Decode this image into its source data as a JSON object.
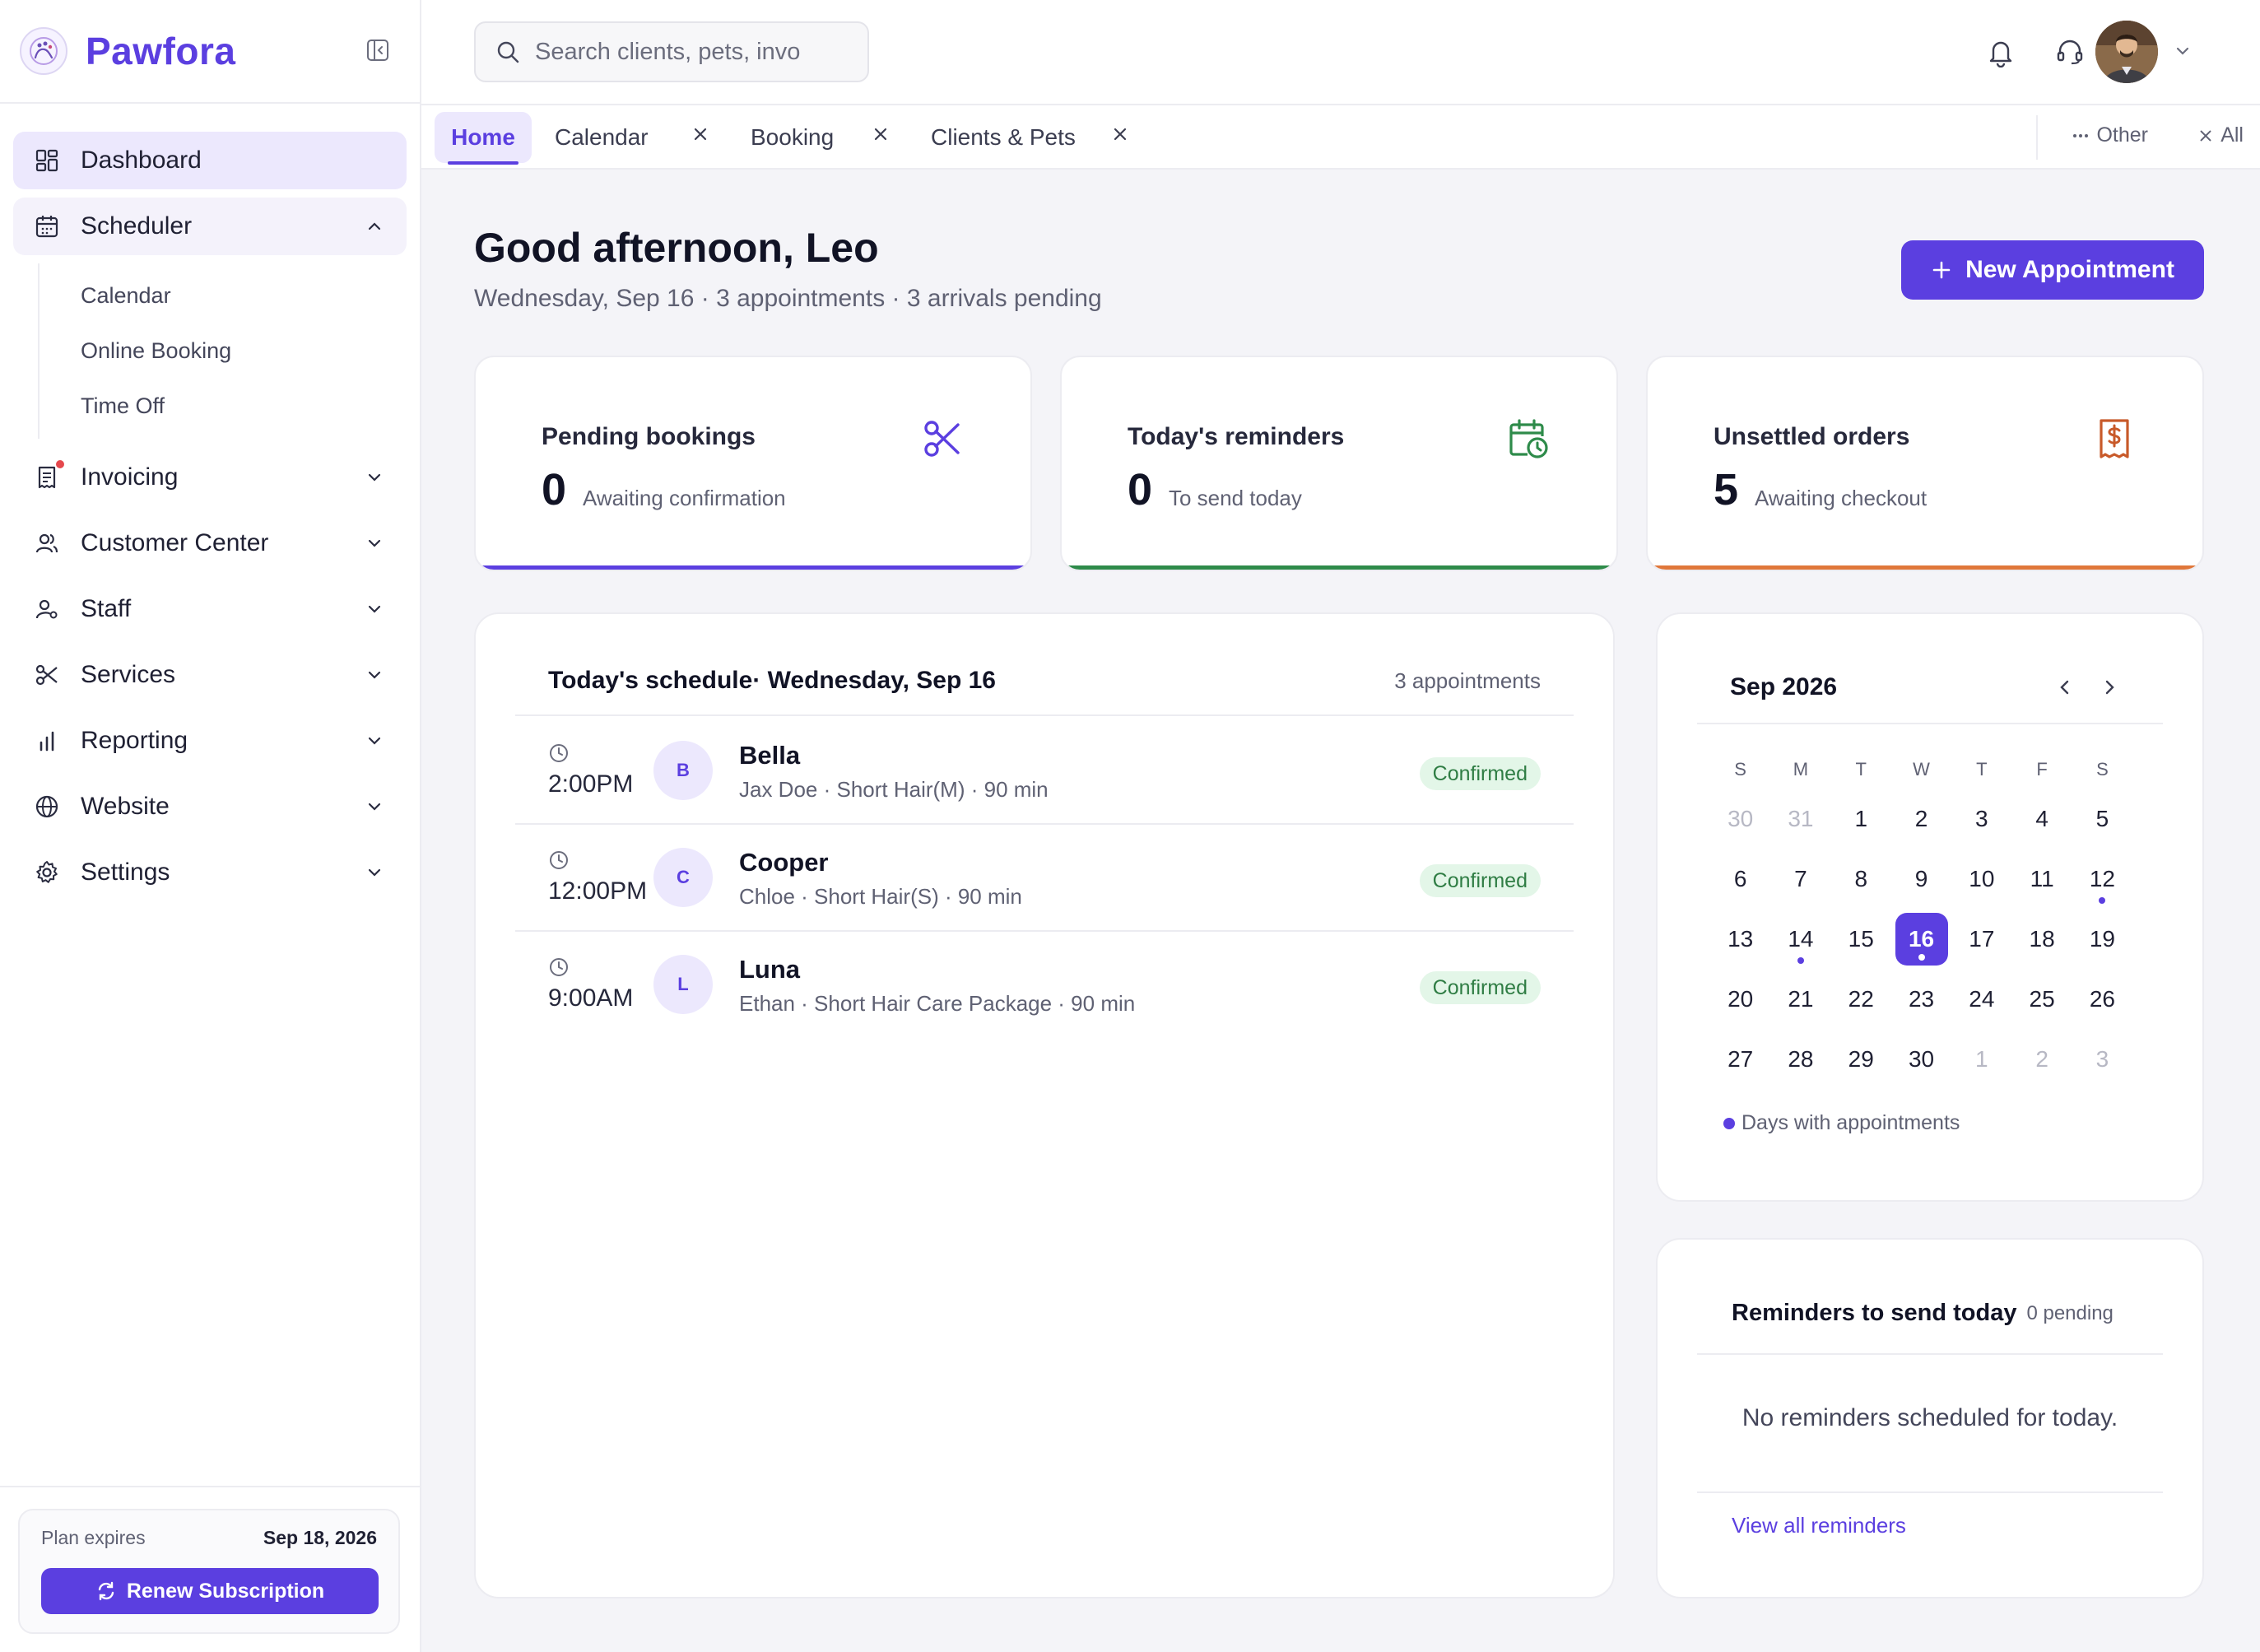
{
  "brand": {
    "name": "Pawfora"
  },
  "sidebar": {
    "items": [
      {
        "label": "Dashboard",
        "icon": "dashboard-icon"
      },
      {
        "label": "Scheduler",
        "icon": "calendar-icon",
        "sub": [
          "Calendar",
          "Online Booking",
          "Time Off"
        ]
      },
      {
        "label": "Invoicing",
        "icon": "invoice-icon",
        "notification": true
      },
      {
        "label": "Customer Center",
        "icon": "users-icon"
      },
      {
        "label": "Staff",
        "icon": "staff-icon"
      },
      {
        "label": "Services",
        "icon": "scissors-icon"
      },
      {
        "label": "Reporting",
        "icon": "bar-chart-icon"
      },
      {
        "label": "Website",
        "icon": "globe-icon"
      },
      {
        "label": "Settings",
        "icon": "gear-icon"
      }
    ],
    "plan": {
      "label": "Plan expires",
      "date": "Sep 18, 2026",
      "renew_label": "Renew Subscription"
    }
  },
  "search": {
    "placeholder": "Search clients, pets, invo"
  },
  "tabs": [
    {
      "label": "Home",
      "active": true
    },
    {
      "label": "Calendar",
      "closable": true
    },
    {
      "label": "Booking",
      "closable": true
    },
    {
      "label": "Clients & Pets",
      "closable": true
    }
  ],
  "tabs_right": {
    "other": "Other",
    "all": "All"
  },
  "greeting": {
    "title": "Good afternoon, Leo",
    "subtitle": "Wednesday, Sep 16 · 3 appointments · 3 arrivals pending",
    "new_button": "New Appointment"
  },
  "stats": [
    {
      "title": "Pending bookings",
      "value": "0",
      "desc": "Awaiting confirmation",
      "color": "#5b3fe0",
      "icon": "scissors-icon"
    },
    {
      "title": "Today's reminders",
      "value": "0",
      "desc": "To send today",
      "color": "#2e8b4a",
      "icon": "calendar-clock-icon"
    },
    {
      "title": "Unsettled orders",
      "value": "5",
      "desc": "Awaiting checkout",
      "color": "#e0773a",
      "icon": "receipt-icon"
    }
  ],
  "schedule": {
    "title": "Today's schedule· Wednesday, Sep 16",
    "count": "3 appointments",
    "appointments": [
      {
        "time": "2:00PM",
        "initial": "B",
        "pet": "Bella",
        "details": "Jax Doe · Short Hair(M) · 90 min",
        "status": "Confirmed"
      },
      {
        "time": "12:00PM",
        "initial": "C",
        "pet": "Cooper",
        "details": "Chloe · Short Hair(S) · 90 min",
        "status": "Confirmed"
      },
      {
        "time": "9:00AM",
        "initial": "L",
        "pet": "Luna",
        "details": "Ethan · Short Hair Care Package · 90 min",
        "status": "Confirmed"
      }
    ]
  },
  "calendar": {
    "month": "Sep 2026",
    "weekdays": [
      "S",
      "M",
      "T",
      "W",
      "T",
      "F",
      "S"
    ],
    "weeks": [
      [
        {
          "d": "30",
          "dim": true
        },
        {
          "d": "31",
          "dim": true
        },
        {
          "d": "1"
        },
        {
          "d": "2"
        },
        {
          "d": "3"
        },
        {
          "d": "4"
        },
        {
          "d": "5"
        }
      ],
      [
        {
          "d": "6"
        },
        {
          "d": "7"
        },
        {
          "d": "8"
        },
        {
          "d": "9"
        },
        {
          "d": "10"
        },
        {
          "d": "11"
        },
        {
          "d": "12",
          "dot": true
        }
      ],
      [
        {
          "d": "13"
        },
        {
          "d": "14",
          "dot": true
        },
        {
          "d": "15"
        },
        {
          "d": "16",
          "selected": true,
          "dot": true
        },
        {
          "d": "17"
        },
        {
          "d": "18"
        },
        {
          "d": "19"
        }
      ],
      [
        {
          "d": "20"
        },
        {
          "d": "21"
        },
        {
          "d": "22"
        },
        {
          "d": "23"
        },
        {
          "d": "24"
        },
        {
          "d": "25"
        },
        {
          "d": "26"
        }
      ],
      [
        {
          "d": "27"
        },
        {
          "d": "28"
        },
        {
          "d": "29"
        },
        {
          "d": "30"
        },
        {
          "d": "1",
          "dim": true
        },
        {
          "d": "2",
          "dim": true
        },
        {
          "d": "3",
          "dim": true
        }
      ]
    ],
    "legend": "Days with appointments"
  },
  "reminders": {
    "title": "Reminders to send today",
    "pending": "0 pending",
    "empty": "No reminders scheduled for today.",
    "link": "View all reminders"
  }
}
